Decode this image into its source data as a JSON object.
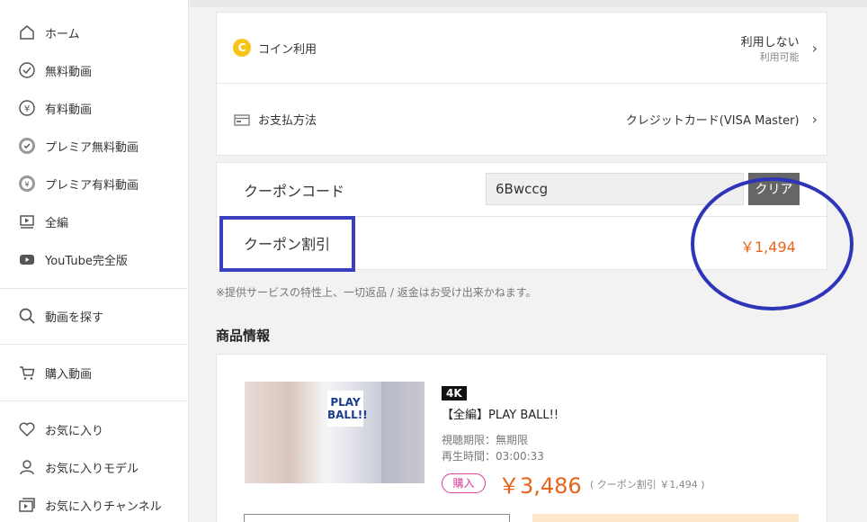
{
  "sidebar": {
    "items": [
      {
        "label": "ホーム",
        "icon": "home-icon"
      },
      {
        "label": "無料動画",
        "icon": "check-circle-icon"
      },
      {
        "label": "有料動画",
        "icon": "yen-circle-icon"
      },
      {
        "label": "プレミア無料動画",
        "icon": "premium-check-icon"
      },
      {
        "label": "プレミア有料動画",
        "icon": "premium-yen-icon"
      },
      {
        "label": "全編",
        "icon": "video-play-icon"
      },
      {
        "label": "YouTube完全版",
        "icon": "youtube-icon"
      }
    ],
    "search_label": "動画を探す",
    "purchased_label": "購入動画",
    "favorites": [
      {
        "label": "お気に入り",
        "icon": "heart-icon"
      },
      {
        "label": "お気に入りモデル",
        "icon": "model-icon"
      },
      {
        "label": "お気に入りチャンネル",
        "icon": "channel-icon"
      }
    ]
  },
  "payment": {
    "coin_icon_letter": "C",
    "coin_label": "コイン利用",
    "coin_value": "利用しない",
    "coin_sub": "利用可能",
    "method_label": "お支払方法",
    "method_value": "クレジットカード(VISA Master)"
  },
  "coupon": {
    "code_label": "クーポンコード",
    "code_value": "6Bwccg",
    "clear_label": "クリア",
    "discount_label": "クーポン割引",
    "discount_value": "￥1,494"
  },
  "note": "※提供サービスの特性上、一切返品 / 返金はお受け出来かねます。",
  "product": {
    "section_title": "商品情報",
    "badge": "4K",
    "title": "【全編】PLAY BALL!!",
    "period": "視聴期限：無期限",
    "duration": "再生時間：03:00:33",
    "buy_label": "購入",
    "price": "￥3,486",
    "coupon_note": "( クーポン割引 ￥1,494 )",
    "thumb_text": "PLAY BALL!!"
  },
  "colors": {
    "accent_orange": "#e8641b",
    "annotation_blue": "#2f35b8",
    "coin_yellow": "#f5c518",
    "buy_pink": "#d8409a"
  }
}
